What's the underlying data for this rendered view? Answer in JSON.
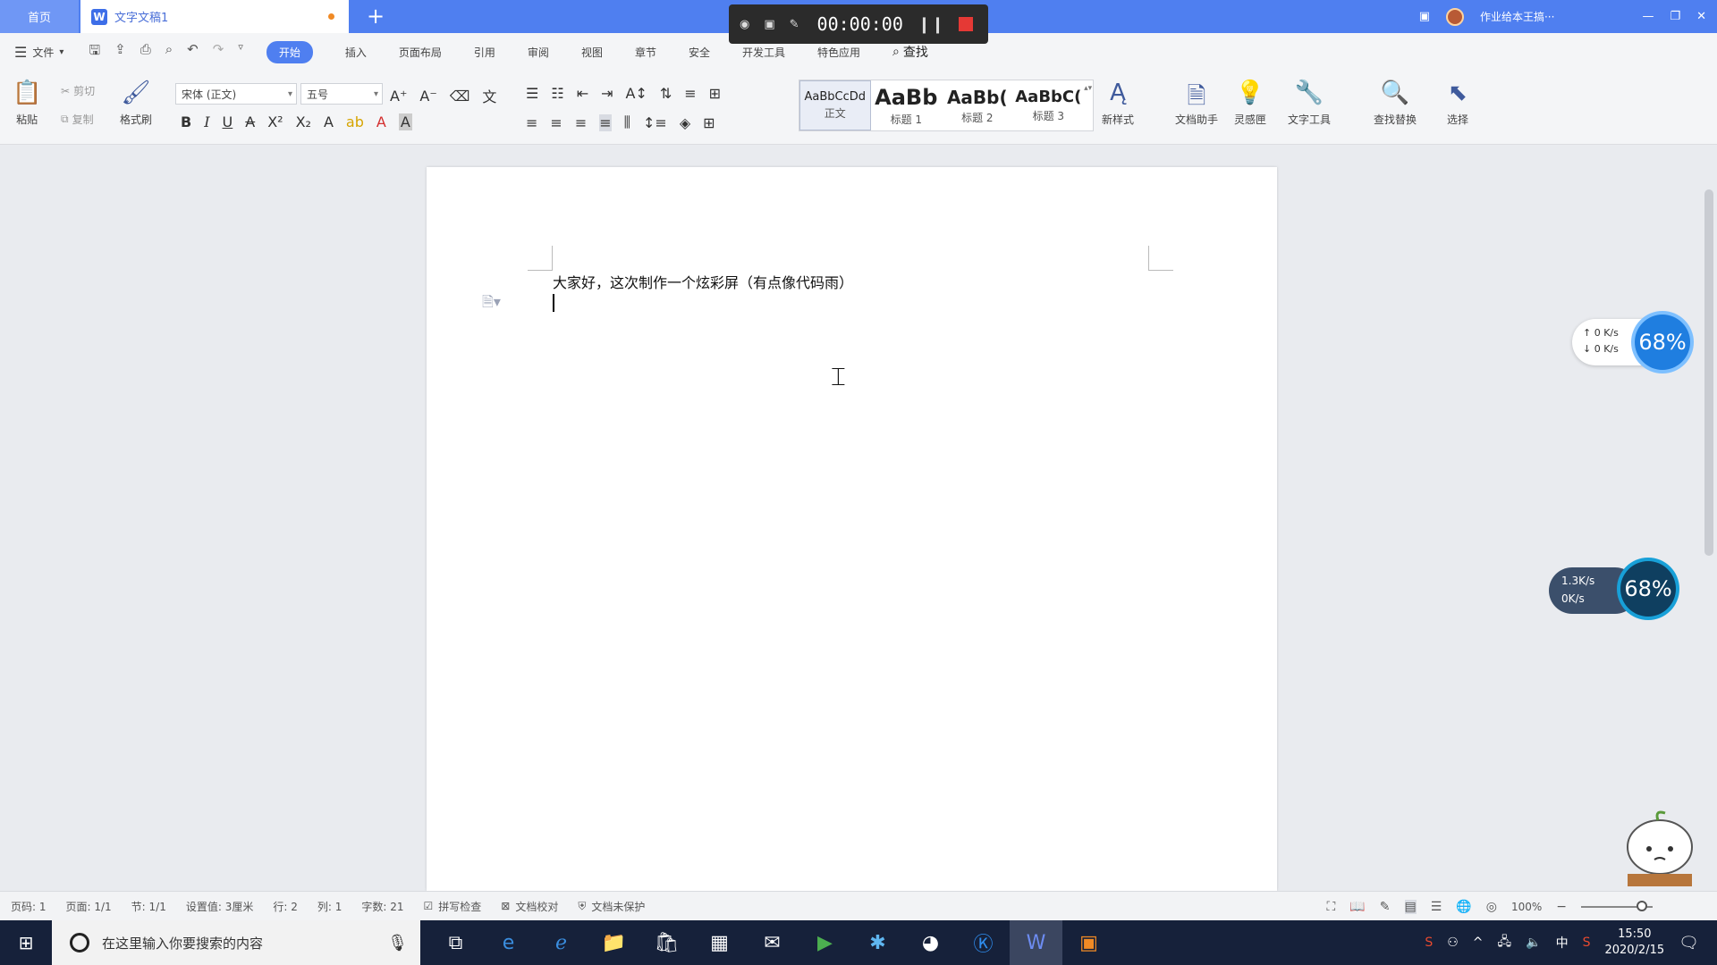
{
  "titlebar": {
    "home_tab": "首页",
    "doc_tab": "文字文稿1",
    "doc_icon": "W",
    "new_tab": "+",
    "recorder_time": "00:00:00",
    "user_name": "作业给本王搞···"
  },
  "menu": {
    "file": "文件",
    "tabs": [
      "开始",
      "插入",
      "页面布局",
      "引用",
      "审阅",
      "视图",
      "章节",
      "安全",
      "开发工具",
      "特色应用"
    ],
    "active_tab": "开始",
    "find": "查找"
  },
  "ribbon": {
    "paste": "粘贴",
    "cut": "剪切",
    "copy": "复制",
    "format_painter": "格式刷",
    "font_name": "宋体 (正文)",
    "font_size": "五号",
    "styles": [
      {
        "preview": "AaBbCcDd",
        "label": "正文"
      },
      {
        "preview": "AaBb",
        "label": "标题 1"
      },
      {
        "preview": "AaBb(",
        "label": "标题 2"
      },
      {
        "preview": "AaBbC(",
        "label": "标题 3"
      }
    ],
    "new_style": "新样式",
    "doc_assistant": "文档助手",
    "inspiration": "灵感匣",
    "text_tools": "文字工具",
    "find_replace": "查找替换",
    "select": "选择"
  },
  "document": {
    "line1": "大家好，这次制作一个炫彩屏（有点像代码雨）"
  },
  "widgets": {
    "net1_up": "0  K/s",
    "net1_down": "0  K/s",
    "net1_pct": "68%",
    "net2_up": "1.3K/s",
    "net2_down": "0K/s",
    "net2_pct": "68%"
  },
  "status": {
    "page_num": "页码: 1",
    "pages": "页面: 1/1",
    "section": "节: 1/1",
    "position": "设置值: 3厘米",
    "row": "行: 2",
    "col": "列: 1",
    "word_count": "字数: 21",
    "spell_check": "拼写检查",
    "doc_proof": "文档校对",
    "doc_protect": "文档未保护",
    "zoom": "100%"
  },
  "taskbar": {
    "search_placeholder": "在这里输入你要搜索的内容",
    "ime": "中",
    "time": "15:50",
    "date": "2020/2/15"
  }
}
